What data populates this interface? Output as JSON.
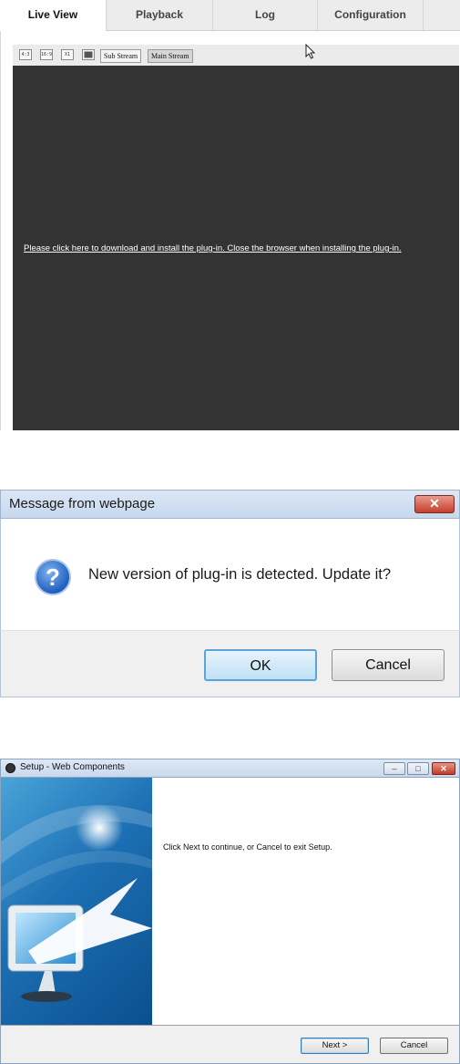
{
  "live_view": {
    "tabs": [
      {
        "label": "Live View"
      },
      {
        "label": "Playback"
      },
      {
        "label": "Log"
      },
      {
        "label": "Configuration"
      }
    ],
    "toolbar": {
      "ratio_4_3": "4:3",
      "ratio_16_9": "16:9",
      "ratio_x1": "X1",
      "sub_stream_label": "Sub Stream",
      "main_stream_label": "Main Stream"
    },
    "plugin_message": "Please click here to download and install the plug-in. Close the browser when installing the plug-in."
  },
  "message_dialog": {
    "title": "Message from webpage",
    "close_glyph": "✕",
    "icon_glyph": "?",
    "message": "New version of plug-in is detected. Update it?",
    "ok_label": "OK",
    "cancel_label": "Cancel"
  },
  "setup_wizard": {
    "title": "Setup - Web Components",
    "minimize_glyph": "–",
    "maximize_glyph": "□",
    "close_glyph": "✕",
    "message": "Click Next to continue, or Cancel to exit Setup.",
    "next_label": "Next >",
    "cancel_label": "Cancel"
  },
  "colors": {
    "video_background": "#333333",
    "dialog_ok_border": "#5aa5d6",
    "close_button_red": "#c4402d"
  }
}
